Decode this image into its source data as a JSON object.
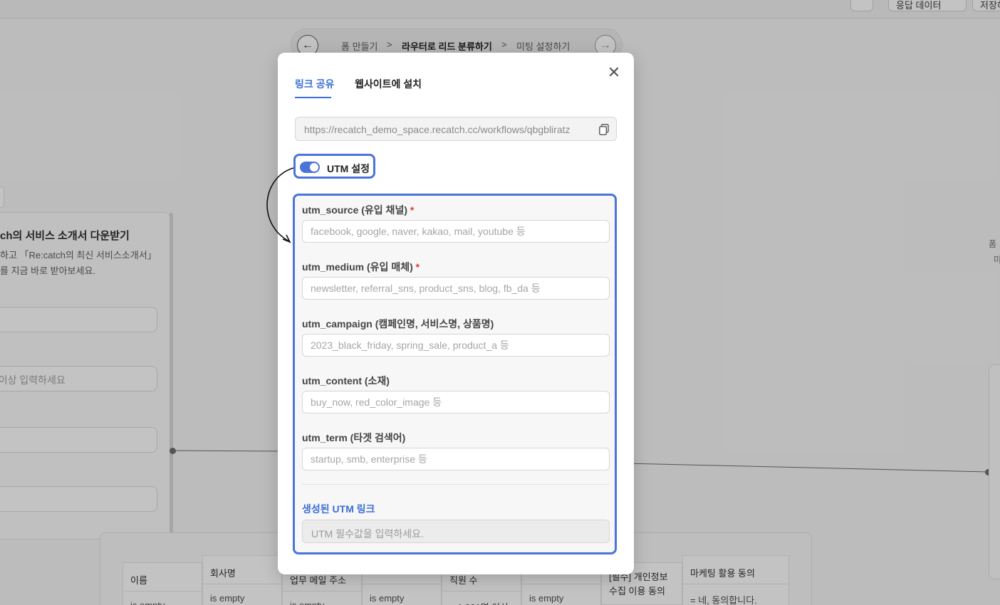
{
  "background": {
    "top_buttons": [
      "",
      "응답 데이터",
      "저장하"
    ],
    "breadcrumb": {
      "step1": "폼 만들기",
      "sep1": ">",
      "step2": "라우터로 리드 분류하기",
      "sep2": ">",
      "step3": "미팅 설정하기"
    },
    "left_card": {
      "title": "ch의 서비스 소개서 다운받기",
      "desc_line1": "하고 「Re:catch의 최신 서비스소개서」",
      "desc_line2": "를 지금 바로 받아보세요.",
      "input2_placeholder": "자 이상 입력하세요"
    },
    "right_labels": [
      "폼",
      "미"
    ],
    "table": {
      "headers": [
        "이름",
        "회사명",
        "업무 메일 주소",
        "",
        "직원 수",
        "",
        "[필수] 개인정보 수집 이용 동의",
        "마케팅 활용 동의"
      ],
      "cells": [
        "is empty",
        "is empty",
        "is empty",
        "is empty",
        "= 1,001명 이상",
        "is empty",
        "",
        "= 네, 동의합니다."
      ]
    }
  },
  "modal": {
    "tabs": [
      {
        "label": "링크 공유",
        "active": true
      },
      {
        "label": "웹사이트에 설치",
        "active": false
      }
    ],
    "share_url": "https://recatch_demo_space.recatch.cc/workflows/qbgbliratz",
    "utm_toggle": {
      "label": "UTM 설정",
      "enabled": true
    },
    "fields": [
      {
        "label": "utm_source (유입 채널)",
        "required": true,
        "placeholder": "facebook, google, naver, kakao, mail, youtube 등",
        "value": ""
      },
      {
        "label": "utm_medium (유입 매체)",
        "required": true,
        "placeholder": "newsletter, referral_sns, product_sns, blog, fb_da 등",
        "value": ""
      },
      {
        "label": "utm_campaign (캠페인명, 서비스명, 상품명)",
        "required": false,
        "placeholder": "2023_black_friday, spring_sale, product_a 등",
        "value": ""
      },
      {
        "label": "utm_content (소재)",
        "required": false,
        "placeholder": "buy_now, red_color_image 등",
        "value": ""
      },
      {
        "label": "utm_term (타겟 검색어)",
        "required": false,
        "placeholder": "startup, smb, enterprise 등",
        "value": ""
      }
    ],
    "required_mark": "*",
    "generated": {
      "label": "생성된 UTM 링크",
      "placeholder": "UTM 필수값을 입력하세요."
    }
  },
  "colors": {
    "accent": "#3b6fd6",
    "highlight_border": "#4a74d8",
    "required": "#d93c3c"
  }
}
